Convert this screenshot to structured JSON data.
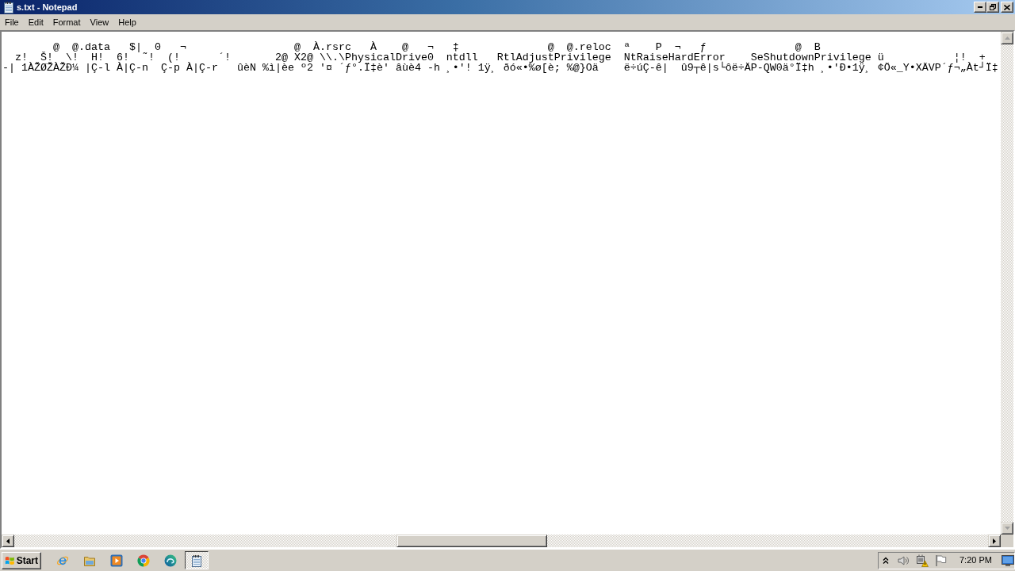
{
  "window": {
    "title": "s.txt - Notepad"
  },
  "menu": [
    "File",
    "Edit",
    "Format",
    "View",
    "Help"
  ],
  "document": {
    "lines": [
      "        @  @.data   $|  0   ¬                 @  À.rsrc   À    @   ¬   ‡              @  @.reloc  ª    P  ¬   ƒ              @  B",
      "  z!  Š!  \\!  H!  6!  ˜!  (!      ´!       2@ X2@ \\\\.\\PhysicalDrive0  ntdll   RtlAdjustPrivilege  NtRaiseHardError    SeShutdownPrivilege ü           ¦!  +",
      "-| 1ÀŽØŽÀŽÐ¼ |Ç-l À|Ç-n  Ç-p À|Ç-r   ûèN %ì|èe º2 '¤ ´ƒ°.Ï‡è' âùè4 -h ¸•'! 1ÿ¸ ðó«•%ø[è; %@}Oä    ë÷úÇ-ê|  û9┬ê|s└ôë÷ÄP-QW0ä°Ï‡h ¸•'Ð•1ÿ¸ ¢Ö«_Y•XÄVP´ƒ¬„Àt┘Ï‡"
    ]
  },
  "taskbar": {
    "start": "Start",
    "windows": [
      {
        "selected": true
      }
    ]
  },
  "tray": {
    "clock": "7:20 PM"
  }
}
